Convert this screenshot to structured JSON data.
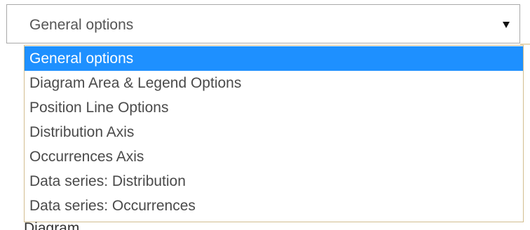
{
  "select": {
    "current_value": "General options",
    "arrow_icon": "caret-down-icon"
  },
  "dropdown": {
    "options": [
      {
        "label": "General options",
        "selected": true
      },
      {
        "label": "Diagram Area & Legend Options",
        "selected": false
      },
      {
        "label": "Position Line Options",
        "selected": false
      },
      {
        "label": "Distribution Axis",
        "selected": false
      },
      {
        "label": "Occurrences Axis",
        "selected": false
      },
      {
        "label": "Data series: Distribution",
        "selected": false
      },
      {
        "label": "Data series: Occurrences",
        "selected": false
      }
    ],
    "highlight_color": "#1e90ff"
  },
  "below_text": "Diagram"
}
